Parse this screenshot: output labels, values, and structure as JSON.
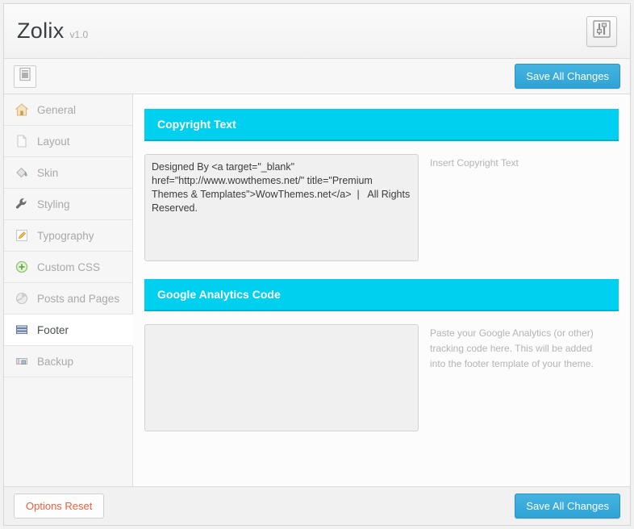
{
  "header": {
    "title": "Zolix",
    "version": "v1.0",
    "settings_icon": "sliders-icon"
  },
  "toolbar": {
    "layout_icon": "panel-layout-icon",
    "save_label": "Save All Changes"
  },
  "sidebar": {
    "items": [
      {
        "label": "General",
        "icon": "house-icon",
        "active": false
      },
      {
        "label": "Layout",
        "icon": "page-icon",
        "active": false
      },
      {
        "label": "Skin",
        "icon": "paint-bucket-icon",
        "active": false
      },
      {
        "label": "Styling",
        "icon": "wrench-icon",
        "active": false
      },
      {
        "label": "Typography",
        "icon": "pencil-edit-icon",
        "active": false
      },
      {
        "label": "Custom CSS",
        "icon": "plus-circle-icon",
        "active": false
      },
      {
        "label": "Posts and Pages",
        "icon": "pie-chart-icon",
        "active": false
      },
      {
        "label": "Footer",
        "icon": "stacked-lines-icon",
        "active": true
      },
      {
        "label": "Backup",
        "icon": "floppy-disk-icon",
        "active": false
      }
    ]
  },
  "sections": [
    {
      "title": "Copyright Text",
      "textarea_value": "Designed By <a target=\"_blank\" href=\"http://www.wowthemes.net/\" title=\"Premium Themes & Templates\">WowThemes.net</a>  |   All Rights Reserved.",
      "textarea_placeholder": "",
      "hint": "Insert Copyright Text"
    },
    {
      "title": "Google Analytics Code",
      "textarea_value": "",
      "textarea_placeholder": "",
      "hint": "Paste your Google Analytics (or other) tracking code here. This will be added into the footer template of your theme."
    }
  ],
  "footer": {
    "reset_label": "Options Reset",
    "save_label": "Save All Changes"
  },
  "colors": {
    "accent": "#00d0ef",
    "save_button": "#2fa3d6",
    "reset_text": "#f0603c"
  }
}
